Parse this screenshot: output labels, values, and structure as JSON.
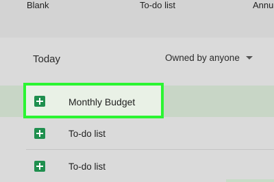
{
  "templates": [
    {
      "label": "Blank"
    },
    {
      "label": "To-do list"
    },
    {
      "label": "Annu"
    }
  ],
  "recent": {
    "section_title": "Today",
    "owner_filter": "Owned by anyone",
    "files": [
      {
        "name": "Monthly Budget",
        "icon": "sheets-icon",
        "selected": true
      },
      {
        "name": "To-do list",
        "icon": "sheets-icon",
        "selected": false
      },
      {
        "name": "To-do list",
        "icon": "sheets-icon",
        "selected": false
      }
    ]
  },
  "colors": {
    "highlight": "#2bf532",
    "sheets_green": "#1f8f4e",
    "selected_row": "#c8d6c6"
  }
}
